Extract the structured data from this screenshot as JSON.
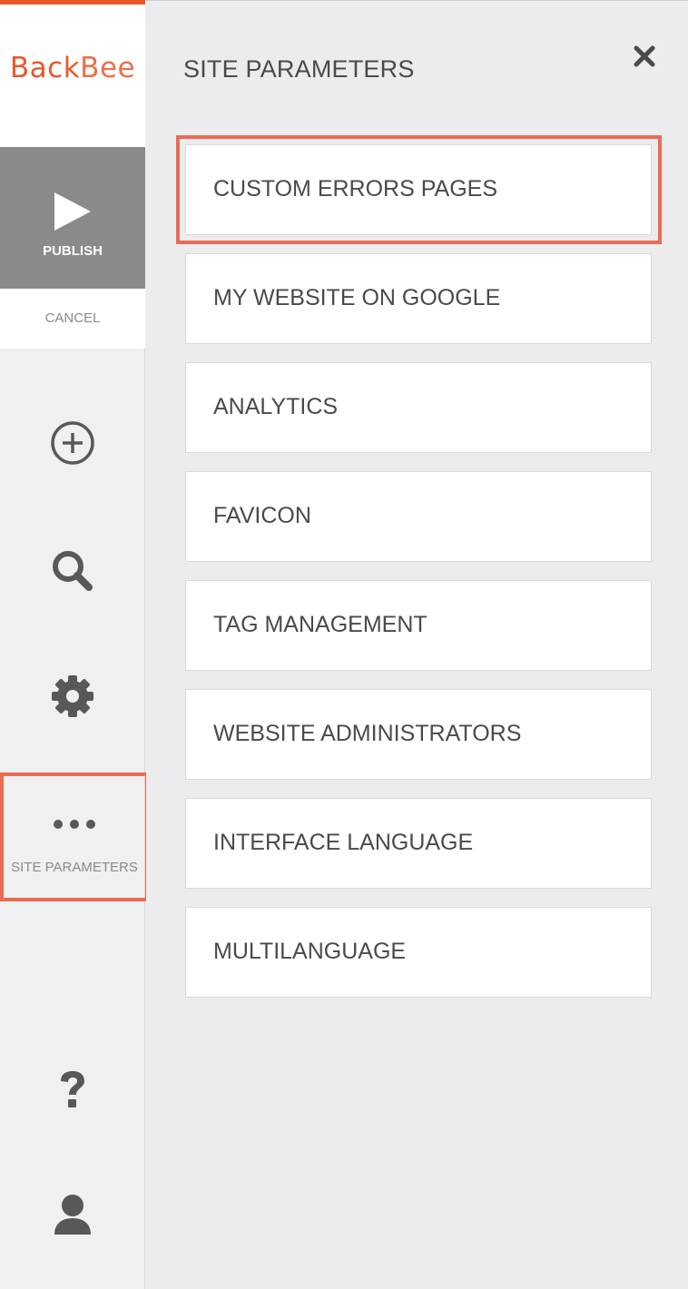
{
  "sidebar": {
    "logo": {
      "part1": "Back",
      "part2": "Bee"
    },
    "publish_label": "PUBLISH",
    "cancel_label": "CANCEL",
    "site_parameters_label": "SITE PARAMETERS",
    "icons": [
      "add-circle-icon",
      "search-icon",
      "gear-icon",
      "more-dots-icon",
      "help-icon",
      "user-icon"
    ]
  },
  "panel": {
    "title": "SITE PARAMETERS",
    "items": [
      {
        "label": "CUSTOM ERRORS PAGES"
      },
      {
        "label": "MY WEBSITE ON GOOGLE"
      },
      {
        "label": "ANALYTICS"
      },
      {
        "label": "FAVICON"
      },
      {
        "label": "TAG MANAGEMENT"
      },
      {
        "label": "WEBSITE ADMINISTRATORS"
      },
      {
        "label": "INTERFACE LANGUAGE"
      },
      {
        "label": "MULTILANGUAGE"
      }
    ]
  },
  "colors": {
    "accent": "#e8582a",
    "highlight": "#ec6b53",
    "publish_bg": "#8a898b",
    "icon": "#58575a"
  }
}
